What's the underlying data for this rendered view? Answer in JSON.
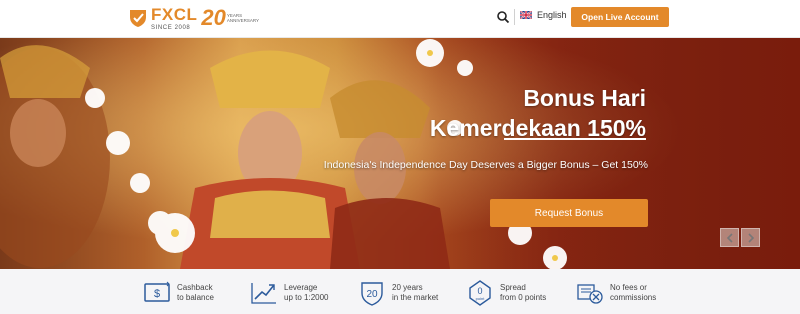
{
  "header": {
    "logo": {
      "name": "FXCL",
      "since": "SINCE 2008",
      "anniversary_number": "20",
      "anniversary_text": "YEARS ANNIVERSARY"
    },
    "language": "English",
    "cta_label": "Open Live Account"
  },
  "hero": {
    "title": "Bonus Hari Kemerdekaan 150%",
    "subtitle": "Indonesia's Independence Day Deserves a Bigger Bonus – Get 150%",
    "cta_label": "Request Bonus"
  },
  "features": [
    {
      "line1": "Cashback",
      "line2": "to balance",
      "icon": "cashback-icon"
    },
    {
      "line1": "Leverage",
      "line2": "up to 1:2000",
      "icon": "leverage-chart-icon"
    },
    {
      "line1": "20 years",
      "line2": "in the market",
      "icon": "shield-20-icon",
      "badge": "20"
    },
    {
      "line1": "Spread",
      "line2": "from 0 points",
      "icon": "spread-0-icon",
      "badge": "0",
      "badge_sub": "point"
    },
    {
      "line1": "No fees or",
      "line2": "commissions",
      "icon": "no-fees-icon"
    }
  ],
  "colors": {
    "accent": "#e3892a",
    "icon_blue": "#2c5b9c",
    "feature_bg": "#f5f5f7"
  }
}
